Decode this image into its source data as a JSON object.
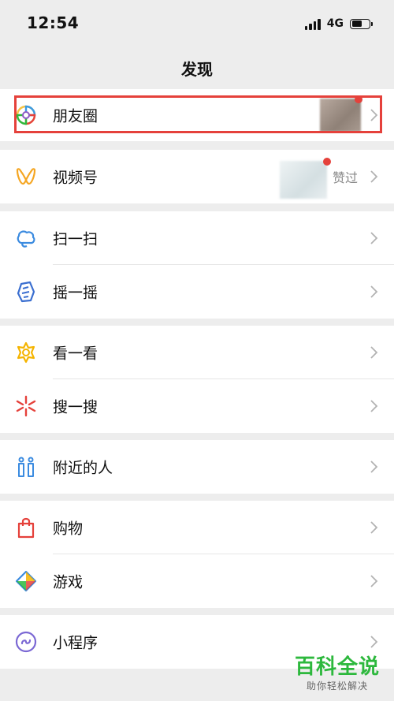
{
  "status_bar": {
    "time": "12:54",
    "network": "4G"
  },
  "nav": {
    "title": "发现"
  },
  "moments": {
    "label": "朋友圈"
  },
  "channels": {
    "label": "视频号",
    "liked_text": "赞过"
  },
  "scan": {
    "label": "扫一扫"
  },
  "shake": {
    "label": "摇一摇"
  },
  "top_stories": {
    "label": "看一看"
  },
  "search": {
    "label": "搜一搜"
  },
  "nearby": {
    "label": "附近的人"
  },
  "shopping": {
    "label": "购物"
  },
  "games": {
    "label": "游戏"
  },
  "mini_programs": {
    "label": "小程序"
  },
  "watermark": {
    "main": "百科全说",
    "sub": "助你轻松解决"
  },
  "colors": {
    "highlight": "#e5413b",
    "background": "#ededed",
    "badge": "#e5413b",
    "watermark": "#2db83d"
  },
  "icons": [
    "moments-icon",
    "channels-icon",
    "scan-icon",
    "shake-icon",
    "top-stories-icon",
    "search-icon",
    "nearby-icon",
    "shopping-icon",
    "games-icon",
    "mini-programs-icon"
  ]
}
